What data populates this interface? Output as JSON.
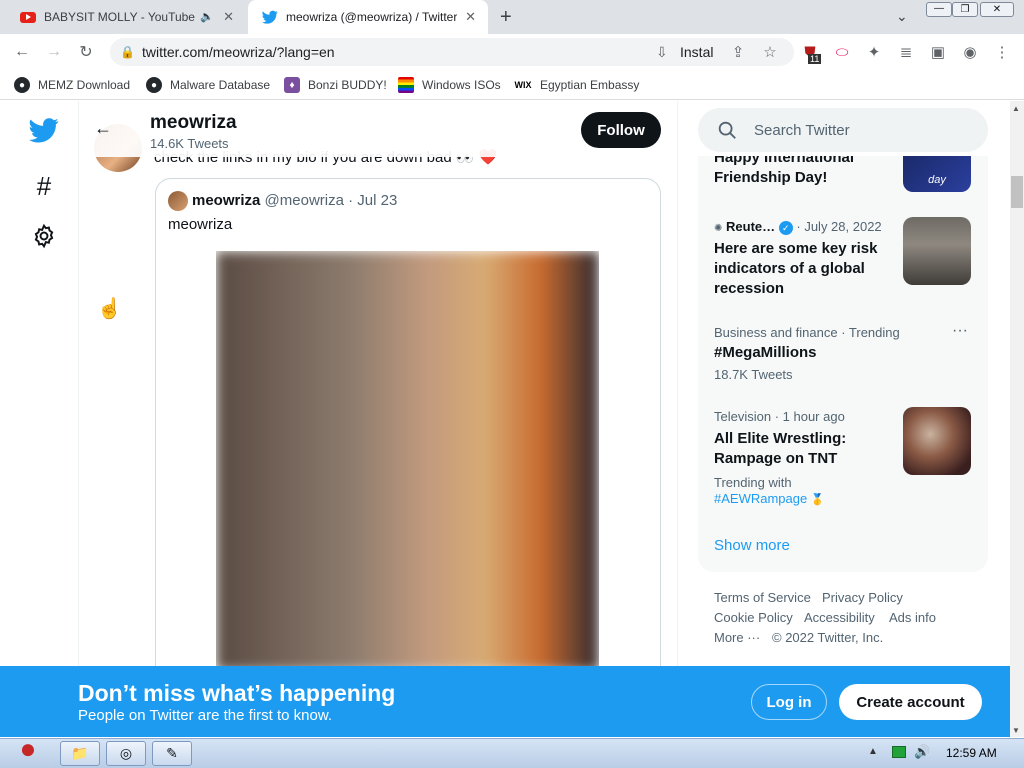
{
  "browser": {
    "tabs": [
      {
        "title": "BABYSIT MOLLY - YouTube",
        "active": false
      },
      {
        "title": "meowriza (@meowriza) / Twitter",
        "active": true
      }
    ],
    "url": "twitter.com/meowriza/?lang=en",
    "install_label": "Instal",
    "extension_badge": "11",
    "bookmarks": [
      {
        "label": "MEMZ Download",
        "icon": "github-icon"
      },
      {
        "label": "Malware Database",
        "icon": "github-icon"
      },
      {
        "label": "Bonzi BUDDY!",
        "icon": "bonzi-icon"
      },
      {
        "label": "Windows ISOs",
        "icon": "windows-flag-icon"
      },
      {
        "label": "Egyptian Embassy",
        "icon": "wix-icon"
      }
    ]
  },
  "profile_header": {
    "name": "meowriza",
    "tweet_count": "14.6K Tweets",
    "follow_label": "Follow"
  },
  "tweet": {
    "text_fragment": "check the links in my bio if you are down bad 👀 ❤️",
    "quote": {
      "name": "meowriza",
      "handle": "@meowriza",
      "date": "· Jul 23",
      "text": "meowriza"
    }
  },
  "sidebar": {
    "search_placeholder": "Search Twitter",
    "items": [
      {
        "meta": "",
        "title": "Happy International Friendship Day!",
        "thumb": "friendship-day-thumbnail"
      },
      {
        "source": "Reute…",
        "meta": "· July 28, 2022",
        "title": "Here are some key risk indicators of a global recession",
        "thumb": "wall-street-thumbnail"
      },
      {
        "meta": "Business and finance · Trending",
        "title": "#MegaMillions",
        "sub": "18.7K Tweets"
      },
      {
        "meta": "Television · 1 hour ago",
        "title": "All Elite Wrestling: Rampage on TNT",
        "sub_prefix": "Trending with",
        "link": "#AEWRampage",
        "thumb": "wrestling-thumbnail"
      }
    ],
    "show_more": "Show more",
    "footer": {
      "row1": [
        "Terms of Service",
        "Privacy Policy"
      ],
      "row2": [
        "Cookie Policy",
        "Accessibility",
        "Ads info"
      ],
      "more": "More ···",
      "copyright": "© 2022 Twitter, Inc."
    }
  },
  "banner": {
    "title": "Don’t miss what’s happening",
    "subtitle": "People on Twitter are the first to know.",
    "login": "Log in",
    "create": "Create account"
  },
  "taskbar": {
    "clock": "12:59 AM"
  },
  "colors": {
    "twitter_blue": "#1d9bf0",
    "follow_black": "#0f1419"
  }
}
